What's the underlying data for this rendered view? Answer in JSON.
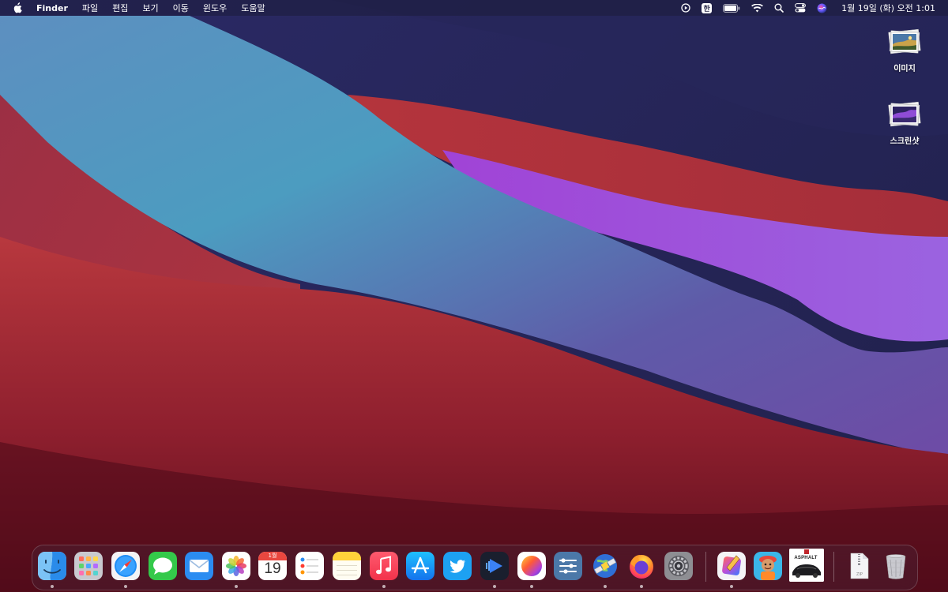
{
  "menubar": {
    "app_name": "Finder",
    "menus": [
      "파일",
      "편집",
      "보기",
      "이동",
      "윈도우",
      "도움말"
    ],
    "status_icons": [
      "play-circle-icon",
      "input-source-icon",
      "battery-icon",
      "wifi-icon",
      "spotlight-icon",
      "control-center-icon",
      "siri-icon"
    ],
    "input_source_label": "한",
    "clock": "1월 19일 (화) 오전  1:01"
  },
  "desktop": {
    "icons": [
      {
        "label": "이미지",
        "icon": "image-stack-icon"
      },
      {
        "label": "스크린샷",
        "icon": "screenshot-stack-icon"
      }
    ]
  },
  "dock": {
    "apps": [
      {
        "name": "Finder",
        "icon": "finder-icon",
        "running": true
      },
      {
        "name": "Launchpad",
        "icon": "launchpad-icon",
        "running": false
      },
      {
        "name": "Safari",
        "icon": "safari-icon",
        "running": true
      },
      {
        "name": "Messages",
        "icon": "messages-icon",
        "running": false
      },
      {
        "name": "Mail",
        "icon": "mail-icon",
        "running": false
      },
      {
        "name": "Photos",
        "icon": "photos-icon",
        "running": true
      },
      {
        "name": "Calendar",
        "icon": "calendar-icon",
        "running": false
      },
      {
        "name": "Reminders",
        "icon": "reminders-icon",
        "running": false
      },
      {
        "name": "Notes",
        "icon": "notes-icon",
        "running": false
      },
      {
        "name": "Music",
        "icon": "music-icon",
        "running": true
      },
      {
        "name": "App Store",
        "icon": "app-store-icon",
        "running": false
      },
      {
        "name": "Twitter",
        "icon": "twitter-icon",
        "running": false
      },
      {
        "name": "Video Player",
        "icon": "video-player-icon",
        "running": true
      },
      {
        "name": "Color App",
        "icon": "color-sphere-icon",
        "running": true
      },
      {
        "name": "Settings Utility",
        "icon": "sliders-icon",
        "running": false
      },
      {
        "name": "Satellite",
        "icon": "satellite-globe-icon",
        "running": true
      },
      {
        "name": "Firefox",
        "icon": "firefox-icon",
        "running": true
      },
      {
        "name": "System Preferences",
        "icon": "system-preferences-icon",
        "running": false
      },
      {
        "name": "Pixelmator",
        "icon": "paint-brush-app-icon",
        "running": true
      },
      {
        "name": "Game Character",
        "icon": "game-character-icon",
        "running": false
      },
      {
        "name": "Asphalt",
        "icon": "asphalt-game-icon",
        "running": false
      },
      {
        "name": "Zip File",
        "icon": "zip-file-icon",
        "running": false
      },
      {
        "name": "Trash",
        "icon": "trash-icon",
        "running": false
      }
    ],
    "calendar": {
      "month": "1월",
      "day": "19"
    },
    "asphalt_label": "ASPHALT",
    "zip_label": "ZIP"
  }
}
